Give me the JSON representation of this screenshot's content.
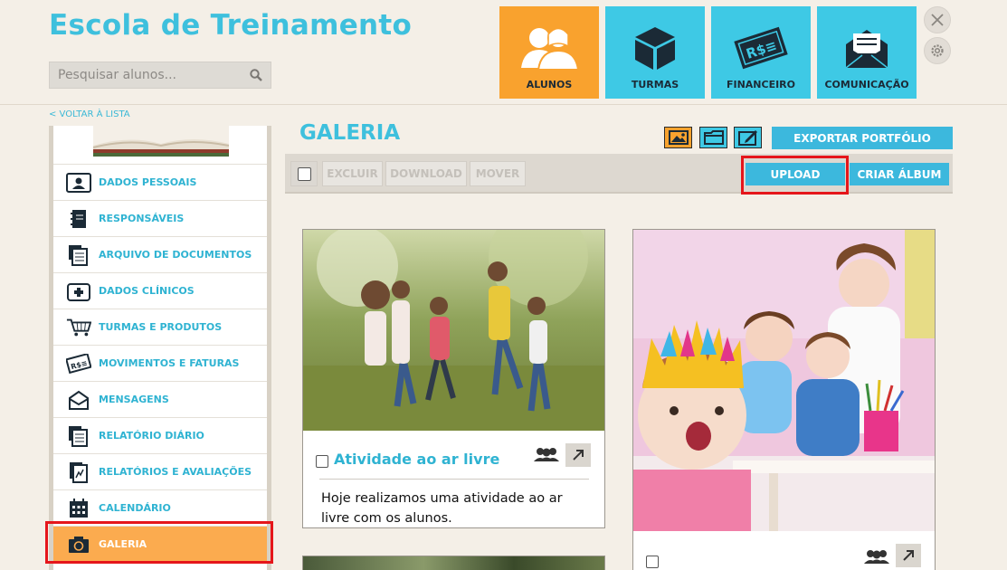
{
  "header": {
    "title": "Escola de Treinamento",
    "search_placeholder": "Pesquisar alunos..."
  },
  "nav": [
    {
      "label": "ALUNOS",
      "icon": "students-icon",
      "active": true
    },
    {
      "label": "TURMAS",
      "icon": "box-icon",
      "active": false
    },
    {
      "label": "FINANCEIRO",
      "icon": "money-icon",
      "active": false
    },
    {
      "label": "COMUNICAÇÃO",
      "icon": "envelope-icon",
      "active": false
    }
  ],
  "back_link": "< VOLTAR À LISTA",
  "sidebar": {
    "items": [
      {
        "label": "DADOS PESSOAIS",
        "icon": "id-card-icon"
      },
      {
        "label": "RESPONSÁVEIS",
        "icon": "notebook-icon"
      },
      {
        "label": "ARQUIVO DE DOCUMENTOS",
        "icon": "documents-icon"
      },
      {
        "label": "DADOS CLÍNICOS",
        "icon": "medical-kit-icon"
      },
      {
        "label": "TURMAS E PRODUTOS",
        "icon": "cart-icon"
      },
      {
        "label": "MOVIMENTOS E FATURAS",
        "icon": "money-icon"
      },
      {
        "label": "MENSAGENS",
        "icon": "envelope-icon"
      },
      {
        "label": "RELATÓRIO DIÁRIO",
        "icon": "documents-icon"
      },
      {
        "label": "RELATÓRIOS E AVALIAÇÕES",
        "icon": "report-icon"
      },
      {
        "label": "CALENDÁRIO",
        "icon": "calendar-icon"
      },
      {
        "label": "GALERIA",
        "icon": "camera-icon",
        "active": true
      }
    ]
  },
  "gallery": {
    "title": "GALERIA",
    "export_label": "EXPORTAR PORTFÓLIO",
    "toolbar": {
      "delete": "EXCLUIR",
      "download": "DOWNLOAD",
      "move": "MOVER",
      "upload": "UPLOAD",
      "create_album": "CRIAR ÁLBUM"
    },
    "cards": [
      {
        "title": "Atividade ao ar livre",
        "description": "Hoje realizamos uma atividade ao ar livre com os alunos."
      },
      {
        "title": "",
        "description": ""
      }
    ]
  },
  "colors": {
    "accent": "#3ec0dd",
    "orange": "#f9a22e",
    "highlight": "#e5161b"
  }
}
